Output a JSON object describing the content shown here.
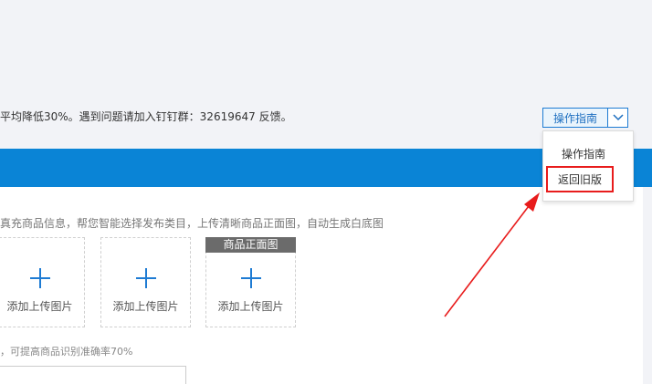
{
  "notice": {
    "text": "平均降低30%。遇到问题请加入钉钉群：32619647 反馈。"
  },
  "guide": {
    "label": "操作指南",
    "caret_icon": "chevron-down-icon"
  },
  "dropdown": {
    "items": [
      {
        "label": "操作指南"
      },
      {
        "label": "返回旧版"
      }
    ]
  },
  "form": {
    "description": "真充商品信息，帮您智能选择发布类目，上传清晰商品正面图，自动生成白底图",
    "uploads": [
      {
        "label": "添加上传图片",
        "tag": ""
      },
      {
        "label": "添加上传图片",
        "tag": ""
      },
      {
        "label": "添加上传图片",
        "tag": "商品正面图"
      }
    ],
    "hint": "，可提高商品识别准确率70%"
  },
  "colors": {
    "accent": "#0a84d6",
    "highlight": "#e81c1c",
    "button_border": "#1e7bd3"
  }
}
